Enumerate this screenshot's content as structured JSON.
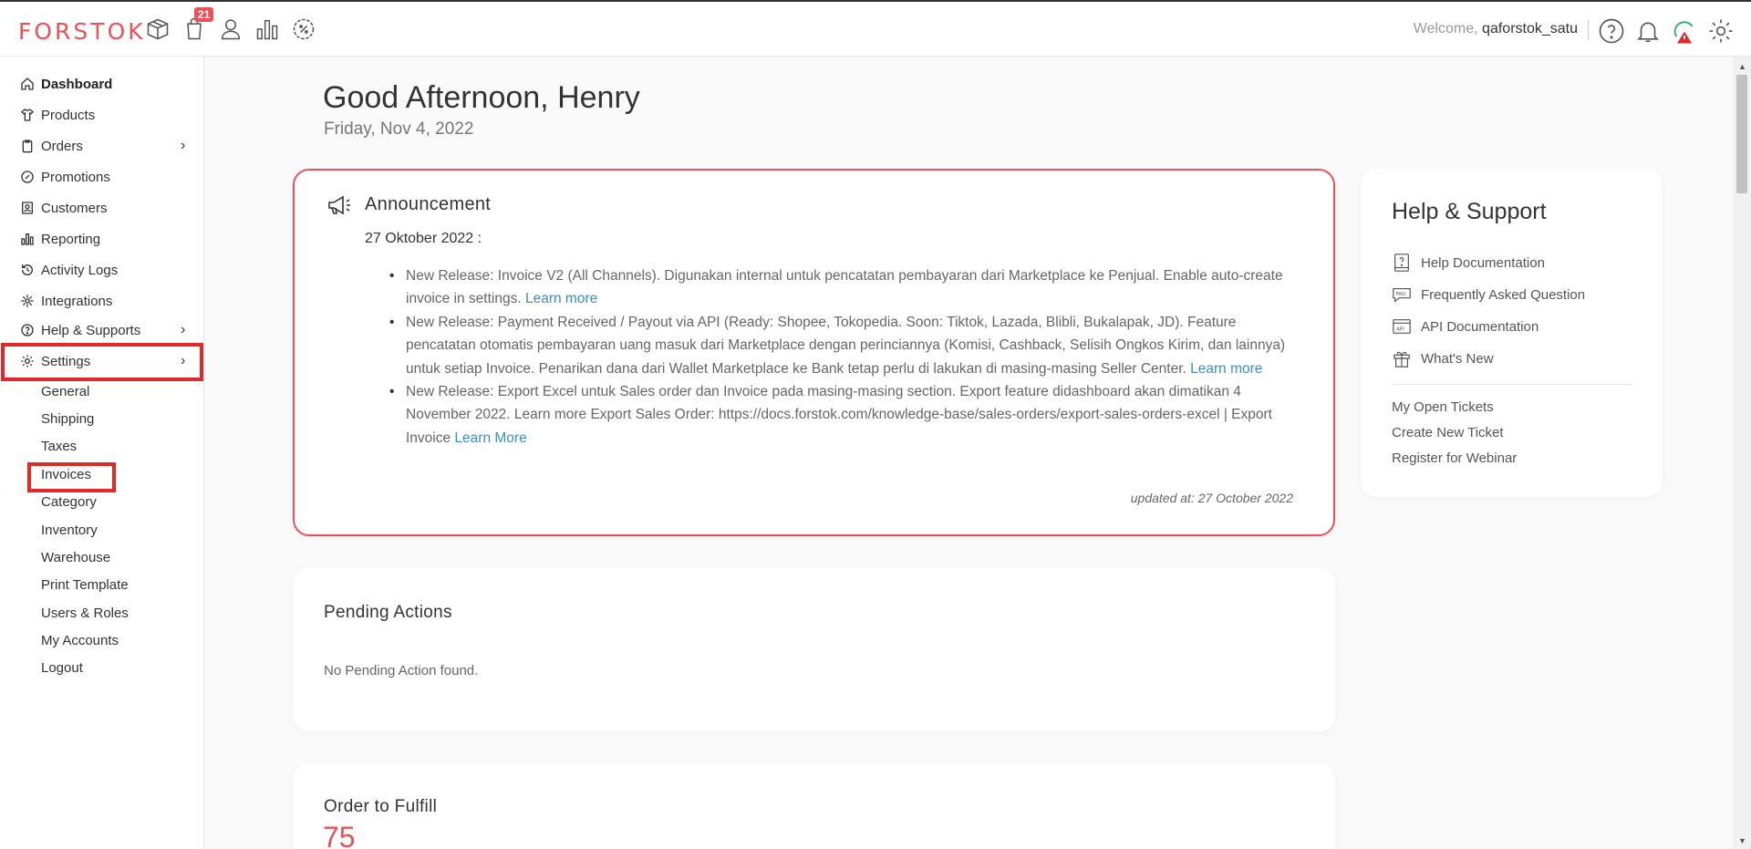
{
  "header": {
    "logo": "FORSTOK",
    "orders_badge": "21",
    "welcome_label": "Welcome,",
    "username": "qaforstok_satu",
    "icons": [
      "box-icon",
      "shopping-bag-icon",
      "user-icon",
      "bar-chart-icon",
      "discount-icon",
      "help-circle-icon",
      "bell-icon",
      "sync-alert-icon",
      "gear-icon"
    ]
  },
  "sidebar": {
    "items": [
      {
        "label": "Dashboard",
        "icon": "home-icon",
        "active": true
      },
      {
        "label": "Products",
        "icon": "tshirt-icon"
      },
      {
        "label": "Orders",
        "icon": "clipboard-icon",
        "chevron": true
      },
      {
        "label": "Promotions",
        "icon": "discount-icon"
      },
      {
        "label": "Customers",
        "icon": "contact-icon"
      },
      {
        "label": "Reporting",
        "icon": "bar-chart-icon"
      },
      {
        "label": "Activity Logs",
        "icon": "history-icon"
      },
      {
        "label": "Integrations",
        "icon": "integrations-icon"
      },
      {
        "label": "Help & Supports",
        "icon": "help-circle-icon",
        "chevron": true
      },
      {
        "label": "Settings",
        "icon": "gear-icon",
        "chevron": true
      }
    ],
    "settings_sub": [
      "General",
      "Shipping",
      "Taxes",
      "Invoices",
      "Category",
      "Inventory",
      "Warehouse",
      "Print Template",
      "Users & Roles",
      "My Accounts",
      "Logout"
    ],
    "highlight_color": "#e02a2a"
  },
  "main": {
    "greeting": "Good Afternoon, Henry",
    "date": "Friday, Nov 4, 2022"
  },
  "announcement": {
    "title": "Announcement",
    "date_heading": "27 Oktober 2022 :",
    "items": [
      {
        "text": "New Release: Invoice V2 (All Channels). Digunakan internal untuk pencatatan pembayaran dari Marketplace ke Penjual. Enable auto-create invoice in settings. ",
        "link": "Learn more"
      },
      {
        "text": "New Release: Payment Received / Payout via API (Ready: Shopee, Tokopedia. Soon: Tiktok, Lazada, Blibli, Bukalapak, JD). Feature pencatatan otomatis pembayaran uang masuk dari Marketplace dengan perinciannya (Komisi, Cashback, Selisih Ongkos Kirim, dan lainnya) untuk setiap Invoice. Penarikan dana dari Wallet Marketplace ke Bank tetap perlu di lakukan di masing-masing Seller Center. ",
        "link": "Learn more"
      },
      {
        "text": "New Release: Export Excel untuk Sales order dan Invoice pada masing-masing section. Export feature didashboard akan dimatikan 4 November 2022. Learn more Export Sales Order: https://docs.forstok.com/knowledge-base/sales-orders/export-sales-orders-excel | Export Invoice ",
        "link": "Learn More"
      }
    ],
    "updated": "updated at: 27 October 2022",
    "border_color": "#e8525a",
    "link_color": "#3c8ec8"
  },
  "help_support": {
    "title": "Help & Support",
    "links": [
      {
        "label": "Help Documentation",
        "icon": "help-doc-icon"
      },
      {
        "label": "Frequently Asked Question",
        "icon": "faq-icon"
      },
      {
        "label": "API Documentation",
        "icon": "api-icon"
      },
      {
        "label": "What's New",
        "icon": "gift-icon"
      }
    ],
    "ticket_links": [
      "My Open Tickets",
      "Create New Ticket",
      "Register for Webinar"
    ]
  },
  "pending_actions": {
    "title": "Pending Actions",
    "empty": "No Pending Action found."
  },
  "order_to_fulfill": {
    "title": "Order to Fulfill",
    "count": "75",
    "count_color": "#e8525a"
  }
}
